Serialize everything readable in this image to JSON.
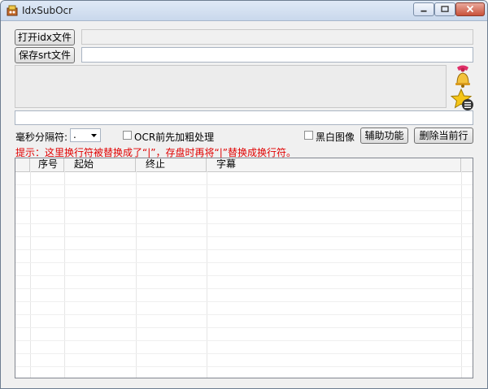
{
  "window": {
    "title": "IdxSubOcr"
  },
  "toolbar": {
    "open_idx_label": "打开idx文件",
    "idx_path_value": "",
    "save_srt_label": "保存srt文件",
    "srt_path_value": ""
  },
  "options": {
    "ms_separator_label": "毫秒分隔符:",
    "ms_separator_value": ".",
    "ocr_bold_label": "OCR前先加粗处理",
    "bw_image_label": "黑白图像",
    "assist_button_label": "辅助功能",
    "delete_row_button_label": "删除当前行"
  },
  "hint": "提示：这里换行符被替换成了“|”，存盘时再将“|”替换成换行符。",
  "table": {
    "columns": [
      "序号",
      "起始",
      "终止",
      "字幕"
    ],
    "rows": []
  },
  "colors": {
    "hint": "#e00000"
  }
}
